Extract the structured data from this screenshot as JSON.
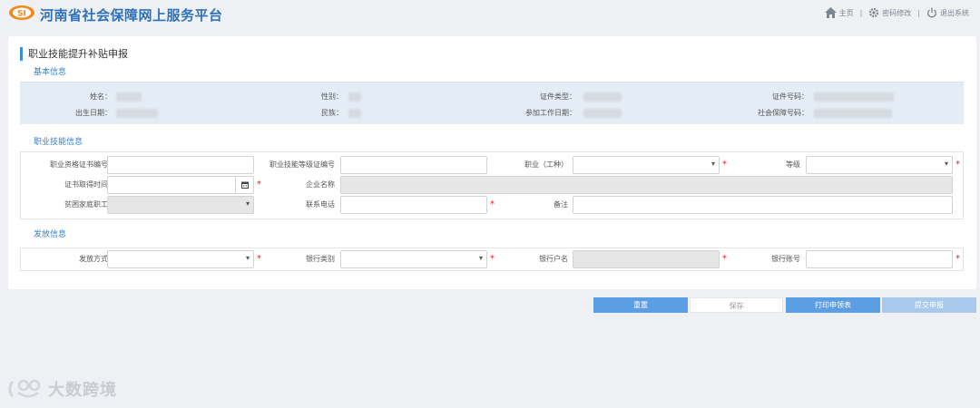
{
  "header": {
    "app_title": "河南省社会保障网上服务平台",
    "nav": {
      "home": "主页",
      "change_password": "密码修改",
      "logout": "退出系统"
    }
  },
  "page": {
    "title": "职业技能提升补贴申报"
  },
  "basic_info": {
    "section_title": "基本信息",
    "labels": {
      "name": "姓名：",
      "gender": "性别：",
      "id_type": "证件类型：",
      "id_number": "证件号码：",
      "birth_date": "出生日期：",
      "ethnicity": "民族：",
      "work_start_date": "参加工作日期：",
      "social_security_no": "社会保障号码："
    }
  },
  "skill_info": {
    "section_title": "职业技能信息",
    "labels": {
      "cert_no": "职业资格证书编号",
      "skill_level_cert_no": "职业技能等级证编号",
      "occupation": "职业（工种）",
      "level": "等级",
      "cert_date": "证书取得时间",
      "company_name": "企业名称",
      "poor_family": "贫困家庭职工",
      "phone": "联系电话",
      "remark": "备注"
    }
  },
  "payment_info": {
    "section_title": "发放信息",
    "labels": {
      "method": "发放方式",
      "bank_type": "银行类别",
      "account_name": "银行户名",
      "account_no": "银行账号"
    }
  },
  "buttons": {
    "reset": "重置",
    "save": "保存",
    "print": "打印申领表",
    "submit": "提交申报"
  },
  "required_mark": "*",
  "watermark": "大数跨境",
  "colors": {
    "brand": "#2f71b8",
    "accent": "#5c9ee4",
    "required": "#e02020",
    "info_bg": "#e4edf5"
  }
}
